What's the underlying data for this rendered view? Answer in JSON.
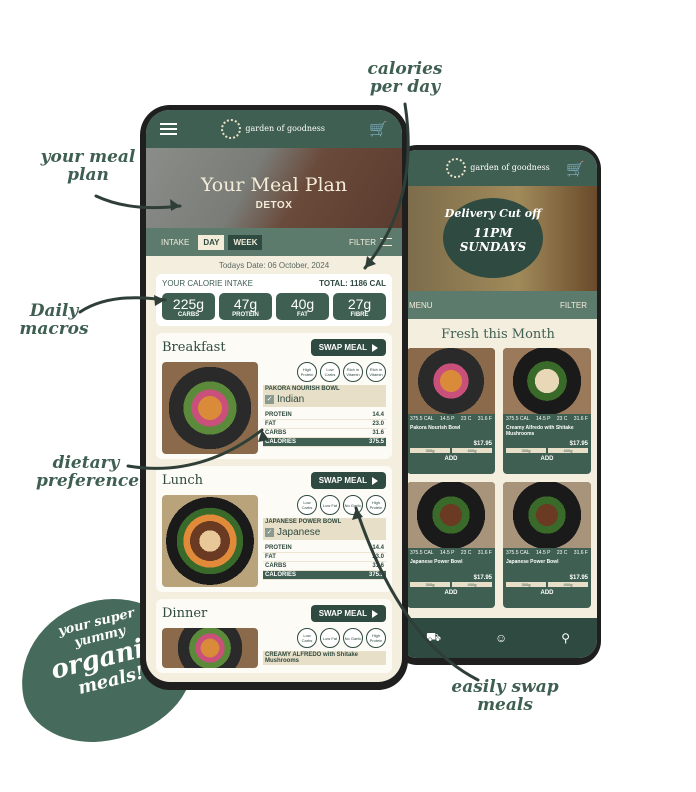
{
  "annotations": {
    "meal_plan": "your meal plan",
    "calories": "calories per day",
    "macros": "Daily macros",
    "dietary": "dietary preference",
    "swap": "easily swap meals",
    "blob": [
      "your super",
      "yummy",
      "organic",
      "meals!"
    ]
  },
  "front": {
    "logo": "garden of goodness",
    "hero_title": "Your Meal Plan",
    "hero_sub": "DETOX",
    "tabs": {
      "intake": "INTAKE",
      "day": "DAY",
      "week": "WEEK",
      "filter": "FILTER"
    },
    "date": "Todays Date: 06 October, 2024",
    "intake_label": "YOUR CALORIE INTAKE",
    "intake_total": "TOTAL: 1186 CAL",
    "macros": [
      {
        "value": "225g",
        "name": "CARBS"
      },
      {
        "value": "47g",
        "name": "PROTEIN"
      },
      {
        "value": "40g",
        "name": "FAT"
      },
      {
        "value": "27g",
        "name": "FIBRE"
      }
    ],
    "swap_label": "SWAP MEAL",
    "meals": [
      {
        "title": "Breakfast",
        "badges": [
          "High Protein",
          "Low Carbs",
          "Rich in Vitamin",
          "Rich in Vitamin"
        ],
        "name": "PAKORA NOURISH BOWL",
        "pref": "Indian",
        "protein": "14.4",
        "fat": "23.0",
        "carbs": "31.6",
        "calories": "375.5"
      },
      {
        "title": "Lunch",
        "badges": [
          "Low Carbs",
          "Low Fat",
          "No Garlic",
          "High Protein"
        ],
        "name": "JAPANESE POWER BOWL",
        "pref": "Japanese",
        "protein": "14.4",
        "fat": "23.0",
        "carbs": "31.6",
        "calories": "375.5"
      },
      {
        "title": "Dinner",
        "badges": [
          "Low Carbs",
          "Low Fat",
          "No Garlic",
          "High Protein"
        ],
        "name": "CREAMY ALFREDO with Shitake Mushrooms"
      }
    ],
    "nut_labels": {
      "protein": "PROTEIN",
      "fat": "FAT",
      "carbs": "CARBS",
      "calories": "CALORIES"
    }
  },
  "back": {
    "logo": "garden of goodness",
    "delivery": "Delivery Cut off",
    "time": "11PM SUNDAYS",
    "menu": "MENU",
    "filter": "FILTER",
    "fresh": "Fresh this Month",
    "cards": [
      {
        "cal": "375.5 CAL",
        "p": "14.5 P",
        "c": "23 C",
        "f": "31.6 F",
        "name": "Pakora Nourish Bowl",
        "price": "$17.95",
        "s1": "300g",
        "s2": "400g",
        "add": "ADD"
      },
      {
        "cal": "375.5 CAL",
        "p": "14.5 P",
        "c": "23 C",
        "f": "31.6 F",
        "name": "Creamy Alfredo with Shitake Mushrooms",
        "price": "$17.95",
        "s1": "300g",
        "s2": "400g",
        "add": "ADD"
      },
      {
        "cal": "375.5 CAL",
        "p": "14.5 P",
        "c": "23 C",
        "f": "31.6 F",
        "name": "Japanese Power Bowl",
        "price": "$17.95",
        "s1": "300g",
        "s2": "400g",
        "add": "ADD"
      },
      {
        "cal": "375.5 CAL",
        "p": "14.5 P",
        "c": "23 C",
        "f": "31.6 F",
        "name": "Japanese Power Bowl",
        "price": "$17.95",
        "s1": "300g",
        "s2": "400g",
        "add": "ADD"
      }
    ]
  }
}
